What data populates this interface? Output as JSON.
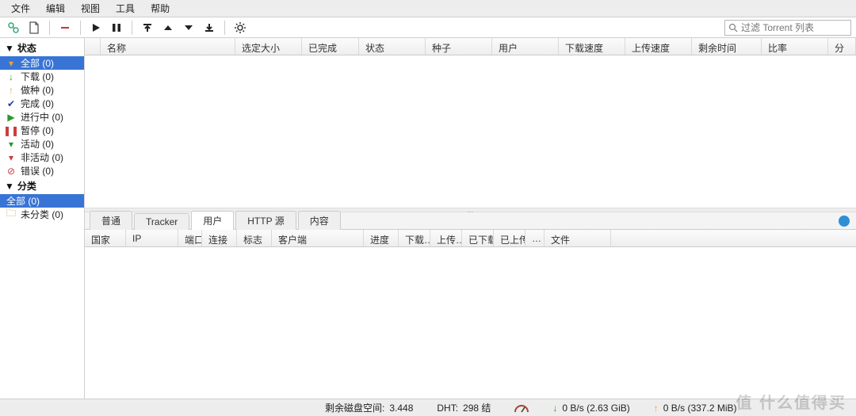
{
  "menu": {
    "file": "文件",
    "edit": "编辑",
    "view": "视图",
    "tools": "工具",
    "help": "帮助"
  },
  "search": {
    "placeholder": "过滤 Torrent 列表"
  },
  "sidebar": {
    "status_header": "状态",
    "items": [
      {
        "label": "全部 (0)"
      },
      {
        "label": "下载 (0)"
      },
      {
        "label": "做种 (0)"
      },
      {
        "label": "完成 (0)"
      },
      {
        "label": "进行中 (0)"
      },
      {
        "label": "暂停 (0)"
      },
      {
        "label": "活动 (0)"
      },
      {
        "label": "非活动 (0)"
      },
      {
        "label": "错误 (0)"
      }
    ],
    "category_header": "分类",
    "cat_all": "全部 (0)",
    "cat_none": "未分类 (0)"
  },
  "columns": {
    "name": "名称",
    "size": "选定大小",
    "done": "已完成",
    "status": "状态",
    "seeds": "种子",
    "peers": "用户",
    "dlspeed": "下载速度",
    "upspeed": "上传速度",
    "eta": "剩余时间",
    "ratio": "比率",
    "more": "分"
  },
  "tabs": {
    "general": "普通",
    "trackers": "Tracker",
    "peers": "用户",
    "http": "HTTP 源",
    "content": "内容"
  },
  "peer_columns": {
    "country": "国家",
    "ip": "IP",
    "port": "端口",
    "conn": "连接",
    "flags": "标志",
    "client": "客户端",
    "progress": "进度",
    "dl": "下载…",
    "up": "上传…",
    "downloaded": "已下载",
    "uploaded": "已上传",
    "dots": "…",
    "files": "文件"
  },
  "status": {
    "disk_label": "剩余磁盘空间:",
    "disk_value": "3.448",
    "dht_label": "DHT:",
    "dht_value": "298 结",
    "dl_rate": "0 B/s (2.63 GiB)",
    "up_rate": "0 B/s (337.2 MiB)"
  },
  "watermark": "值 什么值得买"
}
